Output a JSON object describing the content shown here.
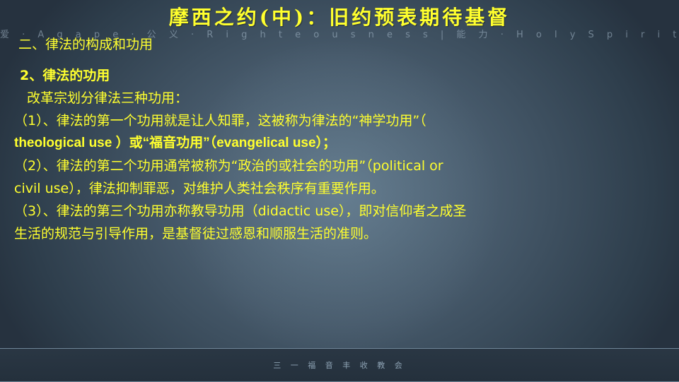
{
  "title": "摩西之约(中)：旧约预表期待基督",
  "watermark": "爱 · A g a p e   ·   公 义 · R i g h t e o u s n e s s   |   能 力 · H o l y   S p i r i t   P o w e r",
  "section_heading": "二、律法的构成和功用",
  "subheading": "2、律法的功用",
  "intro": "改革宗划分律法三种功用：",
  "lines": [
    "（1）、律法的第一个功用就是让人知罪，这被称为律法的“神学功用”（",
    "theological use ）或“福音功用”（evangelical use）；",
    "（2）、律法的第二个功用通常被称为“政治的或社会的功用”（political or",
    "civil use），律法抑制罪恶，对维护人类社会秩序有重要作用。",
    "（3）、律法的第三个功用亦称教导功用（didactic use），即对信仰者之成圣",
    "生活的规范与引导作用，是基督徒过感恩和顺服生活的准则。"
  ],
  "footer": "三 一 福 音 丰 收 教 会",
  "colors": {
    "text": "#ffff2e",
    "background": "#46596a"
  }
}
